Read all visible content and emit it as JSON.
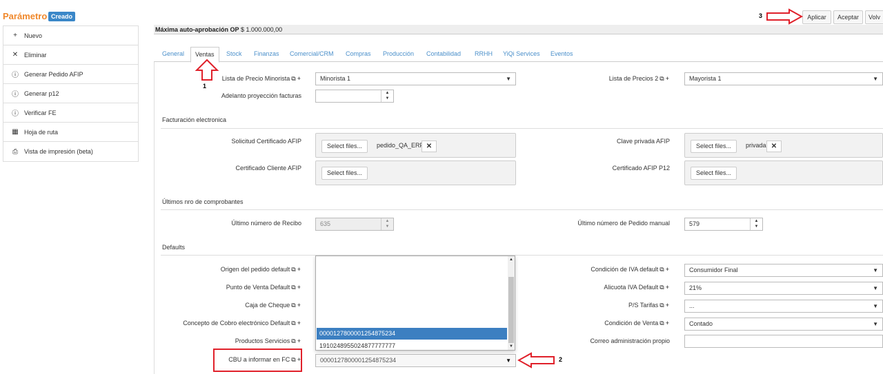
{
  "header": {
    "title": "Parámetro",
    "badge": "Creado"
  },
  "actions": {
    "apply": "Aplicar",
    "accept": "Aceptar",
    "back": "Volv"
  },
  "sidebar": {
    "items": [
      {
        "icon": "plus-icon",
        "glyph": "+",
        "label": "Nuevo"
      },
      {
        "icon": "close-icon",
        "glyph": "✕",
        "label": "Eliminar"
      },
      {
        "icon": "info-circle-icon",
        "glyph": "ⓘ",
        "label": "Generar Pedido AFIP"
      },
      {
        "icon": "info-circle-icon",
        "glyph": "ⓘ",
        "label": "Generar p12"
      },
      {
        "icon": "info-circle-icon",
        "glyph": "ⓘ",
        "label": "Verificar FE"
      },
      {
        "icon": "calendar-icon",
        "glyph": "▦",
        "label": "Hoja de ruta"
      },
      {
        "icon": "printer-icon",
        "glyph": "⎙",
        "label": "Vista de impresión (beta)"
      }
    ]
  },
  "info": {
    "label": "Máxima auto-aprobación OP",
    "value": "$ 1.000.000,00"
  },
  "tabs": [
    "General",
    "Ventas",
    "Stock",
    "Finanzas",
    "Comercial/CRM",
    "Compras",
    "Producción",
    "Contabilidad",
    "RRHH",
    "YiQi Services",
    "Eventos"
  ],
  "form": {
    "lista_minorista_label": "Lista de Precio Minorista",
    "lista_minorista_value": "Minorista 1",
    "lista_precios2_label": "Lista de Precios 2",
    "lista_precios2_value": "Mayorista 1",
    "adelanto_label": "Adelanto proyección facturas",
    "section_fe": "Facturación electronica",
    "solicitud_cert_label": "Solicitud Certificado AFIP",
    "select_files": "Select files...",
    "solicitud_file": "pedido_QA_ERP",
    "clave_privada_label": "Clave privada AFIP",
    "clave_file": "privada",
    "cert_cliente_label": "Certificado Cliente AFIP",
    "cert_p12_label": "Certificado AFIP P12",
    "section_nro": "Últimos nro de comprobantes",
    "ultimo_recibo_label": "Último número de Recibo",
    "ultimo_recibo_value": "635",
    "ultimo_pedido_label": "Último número de Pedido manual",
    "ultimo_pedido_value": "579",
    "section_defaults": "Defaults",
    "origen_label": "Origen del pedido default",
    "punto_venta_label": "Punto de Venta Default",
    "caja_cheque_label": "Caja de Cheque",
    "concepto_cobro_label": "Concepto de Cobro electrónico Default",
    "productos_servicios_label": "Productos Servicios",
    "cbu_label": "CBU a informar en FC",
    "cbu_value": "0000127800001254875234",
    "cond_iva_label": "Condición de IVA default",
    "cond_iva_value": "Consumidor Final",
    "alicuota_label": "Alicuota IVA Default",
    "alicuota_value": "21%",
    "ps_tarifas_label": "P/S Tarifas",
    "ps_tarifas_value": "...",
    "cond_venta_label": "Condición de Venta",
    "cond_venta_value": "Contado",
    "correo_label": "Correo administración propio"
  },
  "dropdown": {
    "options": [
      "0000127800001254875234",
      "1910248955024877777777"
    ]
  },
  "annotations": {
    "n1": "1",
    "n2": "2",
    "n3": "3"
  },
  "colors": {
    "accent": "#f0882b",
    "badge": "#3a87c8",
    "selected": "#3c7fc1",
    "annotation": "#e0202a"
  }
}
